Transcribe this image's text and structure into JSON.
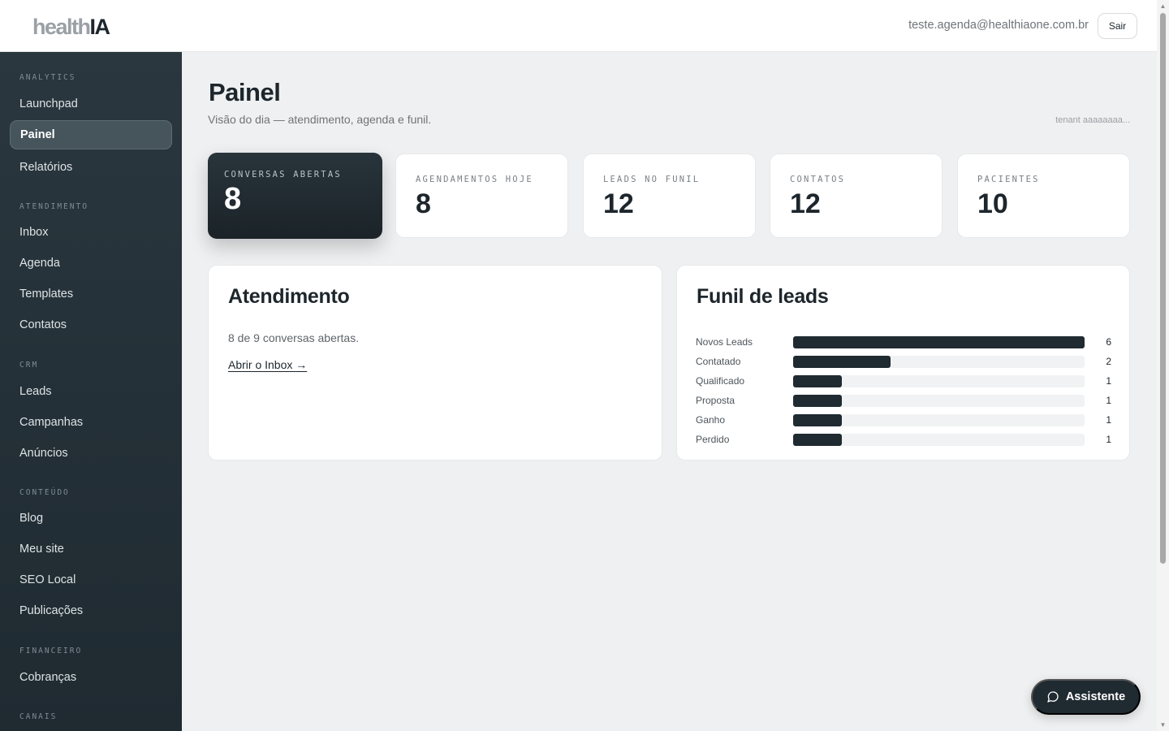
{
  "header": {
    "logo_light": "health",
    "logo_dark": "IA",
    "user_email": "teste.agenda@healthiaone.com.br",
    "logout_label": "Sair"
  },
  "sidebar": {
    "sections": [
      {
        "title": "ANALYTICS",
        "items": [
          {
            "label": "Launchpad"
          },
          {
            "label": "Painel",
            "active": true
          },
          {
            "label": "Relatórios"
          }
        ]
      },
      {
        "title": "ATENDIMENTO",
        "items": [
          {
            "label": "Inbox"
          },
          {
            "label": "Agenda"
          },
          {
            "label": "Templates"
          },
          {
            "label": "Contatos"
          }
        ]
      },
      {
        "title": "CRM",
        "items": [
          {
            "label": "Leads"
          },
          {
            "label": "Campanhas"
          },
          {
            "label": "Anúncios"
          }
        ]
      },
      {
        "title": "CONTEÚDO",
        "items": [
          {
            "label": "Blog"
          },
          {
            "label": "Meu site"
          },
          {
            "label": "SEO Local"
          },
          {
            "label": "Publicações"
          }
        ]
      },
      {
        "title": "FINANCEIRO",
        "items": [
          {
            "label": "Cobranças"
          }
        ]
      },
      {
        "title": "CANAIS",
        "items": []
      }
    ]
  },
  "page": {
    "title": "Painel",
    "subtitle": "Visão do dia — atendimento, agenda e funil.",
    "tenant": "tenant aaaaaaaa..."
  },
  "kpis": [
    {
      "label": "CONVERSAS ABERTAS",
      "value": "8"
    },
    {
      "label": "AGENDAMENTOS HOJE",
      "value": "8"
    },
    {
      "label": "LEADS NO FUNIL",
      "value": "12"
    },
    {
      "label": "CONTATOS",
      "value": "12"
    },
    {
      "label": "PACIENTES",
      "value": "10"
    }
  ],
  "atendimento": {
    "title": "Atendimento",
    "summary": "8 de 9 conversas abertas.",
    "link_label": "Abrir o Inbox →"
  },
  "funil": {
    "title": "Funil de leads",
    "max": 6,
    "rows": [
      {
        "label": "Novos Leads",
        "value": 6
      },
      {
        "label": "Contatado",
        "value": 2
      },
      {
        "label": "Qualificado",
        "value": 1
      },
      {
        "label": "Proposta",
        "value": 1
      },
      {
        "label": "Ganho",
        "value": 1
      },
      {
        "label": "Perdido",
        "value": 1
      }
    ]
  },
  "assistant": {
    "label": "Assistente",
    "icon": "chat-bubble-icon"
  }
}
